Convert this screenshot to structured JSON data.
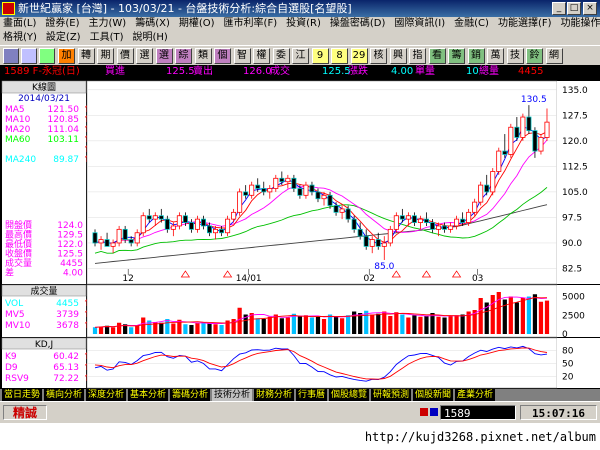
{
  "window": {
    "title": "新世紀贏家 [台灣] - 103/03/21 - 台盤技術分析:綜合自選股[名望股]",
    "min_label": "_",
    "max_label": "□",
    "close_label": "×"
  },
  "menu": {
    "row1": [
      "畫面(L)",
      "證券(E)",
      "主力(W)",
      "籌碼(X)",
      "期權(O)",
      "匯市利率(F)",
      "投資(R)",
      "操盤密碼(D)",
      "國際資訊(I)",
      "金融(C)",
      "功能選擇(F)",
      "功能操作(E)"
    ],
    "row2": [
      "格視(Y)",
      "設定(Z)",
      "工具(T)",
      "說明(H)"
    ]
  },
  "toolbar": {
    "buttons": [
      {
        "label": "加",
        "bg": "#ff8000"
      },
      {
        "label": "轉",
        "bg": "#d4d0c8"
      },
      {
        "label": "期",
        "bg": "#d4d0c8"
      },
      {
        "label": "價",
        "bg": "#d4d0c8"
      },
      {
        "label": "選",
        "bg": "#d4d0c8"
      },
      {
        "label": "選",
        "bg": "#c080c0"
      },
      {
        "label": "綜",
        "bg": "#c080c0"
      },
      {
        "label": "類",
        "bg": "#d4d0c8"
      },
      {
        "label": "個",
        "bg": "#c080c0"
      },
      {
        "label": "智",
        "bg": "#d4d0c8"
      },
      {
        "label": "權",
        "bg": "#d4d0c8"
      },
      {
        "label": "委",
        "bg": "#d4d0c8"
      },
      {
        "label": "江",
        "bg": "#d4d0c8"
      },
      {
        "label": "9",
        "bg": "#ffff80"
      },
      {
        "label": "8",
        "bg": "#ffff80"
      },
      {
        "label": "29",
        "bg": "#ffff80"
      },
      {
        "label": "核",
        "bg": "#d4d0c8"
      },
      {
        "label": "興",
        "bg": "#d4d0c8"
      },
      {
        "label": "指",
        "bg": "#d4d0c8"
      },
      {
        "label": "看",
        "bg": "#80c080"
      },
      {
        "label": "籌",
        "bg": "#80c080"
      },
      {
        "label": "銷",
        "bg": "#80c080"
      },
      {
        "label": "萬",
        "bg": "#d4d0c8"
      },
      {
        "label": "技",
        "bg": "#d4d0c8"
      },
      {
        "label": "鈴",
        "bg": "#80c080"
      },
      {
        "label": "網",
        "bg": "#d4d0c8"
      }
    ]
  },
  "quote": {
    "symbol": "1589 F-永冠(日)",
    "buy_label": "買進",
    "buy_value": "125.5",
    "sell_label": "賣出",
    "sell_value": "126.0",
    "last_label": "成交",
    "last_value": "125.5",
    "change_label": "漲跌",
    "change_value": "4.00",
    "volume_label": "單量",
    "volume_value": "10",
    "total_label": "總量",
    "total_value": "4455"
  },
  "panel": {
    "header": "K線圖",
    "date": "2014/03/21",
    "ma": [
      {
        "name": "MA5",
        "value": "121.50",
        "color": "#ff00ff"
      },
      {
        "name": "MA10",
        "value": "120.85",
        "color": "#ff00ff"
      },
      {
        "name": "MA20",
        "value": "111.04",
        "color": "#ff00ff"
      },
      {
        "name": "MA60",
        "value": "103.11",
        "color": "#00ff00"
      },
      {
        "name": "MA108",
        "value": "97.59",
        "color": "#ffffff"
      },
      {
        "name": "MA240",
        "value": "89.87",
        "color": "#00ffff"
      }
    ],
    "ohlc": [
      {
        "name": "開盤價",
        "value": "124.0"
      },
      {
        "name": "最高價",
        "value": "129.5"
      },
      {
        "name": "最低價",
        "value": "122.0"
      },
      {
        "name": "收盤價",
        "value": "125.5"
      },
      {
        "name": "成交量",
        "value": "4455"
      },
      {
        "name": "差",
        "value": "4.00"
      }
    ]
  },
  "volume_panel": {
    "header": "成交量",
    "items": [
      {
        "name": "VOL",
        "value": "4455",
        "color": "#00ffff"
      },
      {
        "name": "MV5",
        "value": "3739",
        "color": "#ff00ff"
      },
      {
        "name": "MV10",
        "value": "3678",
        "color": "#ff00ff"
      }
    ]
  },
  "kd_panel": {
    "header": "KD,J",
    "items": [
      {
        "name": "K9",
        "value": "60.42",
        "color": "#ff00ff"
      },
      {
        "name": "D9",
        "value": "65.13",
        "color": "#ff00ff"
      },
      {
        "name": "RSV9",
        "value": "72.22",
        "color": "#ff00ff"
      }
    ]
  },
  "chart_data": {
    "type": "candlestick",
    "price_axis": {
      "ticks": [
        "135.0",
        "127.5",
        "120.0",
        "112.5",
        "105.0",
        "97.5",
        "90.0",
        "82.5"
      ],
      "min": 80,
      "max": 137
    },
    "time_axis": {
      "labels": [
        "12",
        "14/01",
        "02",
        "03"
      ]
    },
    "annotations": {
      "high": "130.5",
      "low": "85.0"
    },
    "volume_axis": {
      "ticks": [
        "5000",
        "2500",
        "0"
      ]
    },
    "kd_axis": {
      "ticks": [
        "80",
        "50",
        "20"
      ]
    },
    "candles": [
      [
        93,
        94,
        89,
        90
      ],
      [
        90,
        92,
        88,
        91
      ],
      [
        91,
        93,
        89,
        89
      ],
      [
        89,
        91,
        87,
        90
      ],
      [
        90,
        95,
        89,
        94
      ],
      [
        94,
        95,
        90,
        91
      ],
      [
        91,
        92,
        89,
        90
      ],
      [
        90,
        94,
        89,
        93
      ],
      [
        93,
        99,
        92,
        98
      ],
      [
        98,
        100,
        96,
        97
      ],
      [
        97,
        99,
        95,
        98
      ],
      [
        98,
        100,
        96,
        97
      ],
      [
        97,
        98,
        93,
        94
      ],
      [
        94,
        96,
        92,
        95
      ],
      [
        95,
        99,
        94,
        98
      ],
      [
        98,
        99,
        95,
        96
      ],
      [
        96,
        97,
        93,
        94
      ],
      [
        94,
        98,
        93,
        97
      ],
      [
        97,
        98,
        94,
        95
      ],
      [
        95,
        96,
        92,
        93
      ],
      [
        93,
        95,
        91,
        94
      ],
      [
        94,
        95,
        92,
        93
      ],
      [
        93,
        98,
        92,
        97
      ],
      [
        97,
        100,
        96,
        99
      ],
      [
        99,
        106,
        98,
        105
      ],
      [
        105,
        107,
        103,
        104
      ],
      [
        104,
        108,
        103,
        107
      ],
      [
        107,
        109,
        105,
        106
      ],
      [
        106,
        108,
        104,
        105
      ],
      [
        105,
        107,
        103,
        106
      ],
      [
        106,
        110,
        105,
        109
      ],
      [
        109,
        111,
        107,
        108
      ],
      [
        108,
        110,
        106,
        109
      ],
      [
        109,
        110,
        105,
        106
      ],
      [
        106,
        107,
        103,
        104
      ],
      [
        104,
        108,
        103,
        107
      ],
      [
        107,
        108,
        104,
        105
      ],
      [
        105,
        106,
        102,
        103
      ],
      [
        103,
        105,
        101,
        104
      ],
      [
        104,
        105,
        100,
        101
      ],
      [
        101,
        102,
        98,
        99
      ],
      [
        99,
        101,
        97,
        100
      ],
      [
        100,
        101,
        96,
        97
      ],
      [
        97,
        98,
        93,
        94
      ],
      [
        94,
        96,
        91,
        92
      ],
      [
        92,
        94,
        88,
        89
      ],
      [
        89,
        92,
        87,
        91
      ],
      [
        91,
        93,
        88,
        89
      ],
      [
        89,
        92,
        85,
        90
      ],
      [
        90,
        95,
        89,
        94
      ],
      [
        94,
        99,
        93,
        98
      ],
      [
        98,
        100,
        96,
        97
      ],
      [
        97,
        99,
        95,
        98
      ],
      [
        98,
        99,
        95,
        96
      ],
      [
        96,
        98,
        94,
        97
      ],
      [
        97,
        99,
        95,
        96
      ],
      [
        96,
        97,
        93,
        94
      ],
      [
        94,
        96,
        92,
        95
      ],
      [
        95,
        96,
        93,
        94
      ],
      [
        94,
        96,
        93,
        95
      ],
      [
        95,
        98,
        94,
        97
      ],
      [
        97,
        99,
        95,
        96
      ],
      [
        96,
        100,
        95,
        99
      ],
      [
        99,
        103,
        98,
        102
      ],
      [
        102,
        108,
        101,
        107
      ],
      [
        107,
        110,
        104,
        105
      ],
      [
        105,
        112,
        104,
        111
      ],
      [
        111,
        118,
        110,
        117
      ],
      [
        117,
        122,
        115,
        116
      ],
      [
        116,
        125,
        115,
        124
      ],
      [
        124,
        127,
        120,
        121
      ],
      [
        121,
        128,
        120,
        127
      ],
      [
        127,
        130.5,
        122,
        123
      ],
      [
        123,
        124,
        115,
        117
      ],
      [
        117,
        122,
        116,
        121
      ],
      [
        121,
        129.5,
        120,
        125.5
      ]
    ],
    "volumes": [
      900,
      1000,
      1100,
      900,
      1500,
      1300,
      900,
      1200,
      2200,
      1800,
      1600,
      1500,
      2000,
      1400,
      1900,
      1300,
      1200,
      1500,
      1600,
      1400,
      1300,
      1200,
      1800,
      2000,
      3500,
      2600,
      2800,
      2100,
      2000,
      2300,
      2600,
      2100,
      2200,
      2700,
      2400,
      2500,
      2200,
      2300,
      2000,
      2600,
      2400,
      2100,
      2500,
      3000,
      2800,
      3100,
      2600,
      2700,
      3000,
      2400,
      2900,
      2600,
      2200,
      2500,
      2300,
      2400,
      2800,
      2300,
      2200,
      2400,
      2500,
      2600,
      3000,
      3200,
      4800,
      4200,
      5200,
      5600,
      4600,
      5000,
      4200,
      4800,
      5000,
      5300,
      4300,
      4455
    ]
  },
  "tabs": [
    "當日走勢",
    "橫向分析",
    "深度分析",
    "基本分析",
    "籌碼分析",
    "技術分析",
    "財務分析",
    "行事曆",
    "個股總覽",
    "研報預測",
    "個股新聞",
    "產業分析"
  ],
  "active_tab": 5,
  "status": {
    "mode": "精誠",
    "code": "1589",
    "time": "15:07:16"
  },
  "watermark": "http://kujd3268.pixnet.net/album"
}
